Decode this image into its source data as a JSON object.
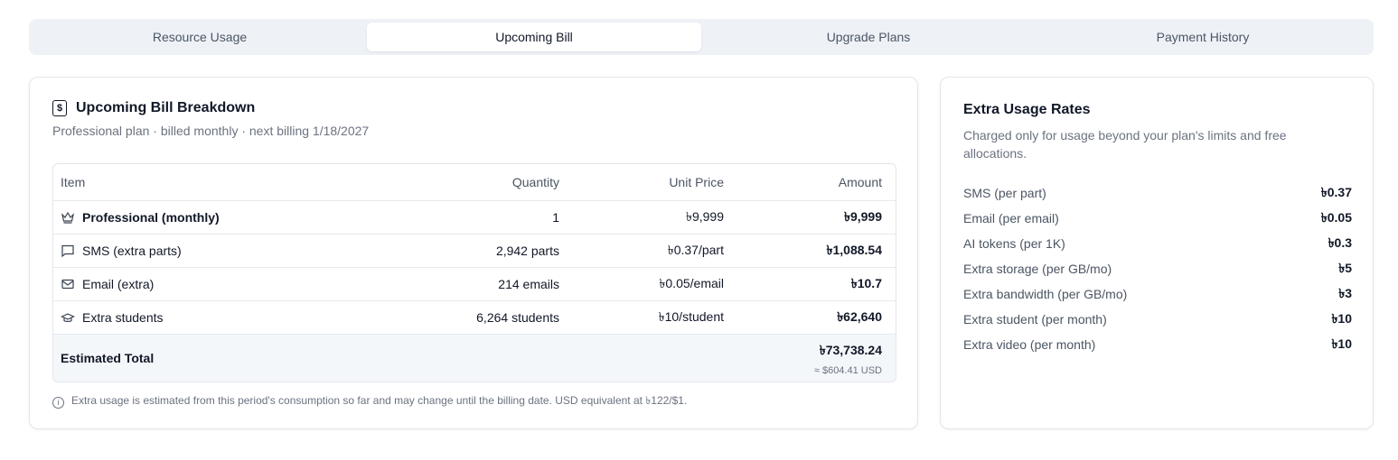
{
  "tabs": [
    {
      "label": "Resource Usage",
      "active": false
    },
    {
      "label": "Upcoming Bill",
      "active": true
    },
    {
      "label": "Upgrade Plans",
      "active": false
    },
    {
      "label": "Payment History",
      "active": false
    }
  ],
  "bill": {
    "icon": "bill-dollar-icon",
    "title": "Upcoming Bill Breakdown",
    "subtitle": "Professional plan · billed monthly · next billing 1/18/2027",
    "columns": {
      "item": "Item",
      "quantity": "Quantity",
      "unit_price": "Unit Price",
      "amount": "Amount"
    },
    "rows": [
      {
        "icon": "crown-icon",
        "item": "Professional (monthly)",
        "quantity": "1",
        "unit_price": "৳9,999",
        "amount": "৳9,999",
        "bold": true
      },
      {
        "icon": "message-icon",
        "item": "SMS (extra parts)",
        "quantity": "2,942 parts",
        "unit_price": "৳0.37/part",
        "amount": "৳1,088.54",
        "bold": false
      },
      {
        "icon": "mail-icon",
        "item": "Email (extra)",
        "quantity": "214 emails",
        "unit_price": "৳0.05/email",
        "amount": "৳10.7",
        "bold": false
      },
      {
        "icon": "graduation-cap-icon",
        "item": "Extra students",
        "quantity": "6,264 students",
        "unit_price": "৳10/student",
        "amount": "৳62,640",
        "bold": false
      }
    ],
    "total": {
      "label": "Estimated Total",
      "amount": "৳73,738.24",
      "usd": "≈ $604.41 USD"
    },
    "note": "Extra usage is estimated from this period's consumption so far and may change until the billing date. USD equivalent at ৳122/$1."
  },
  "rates": {
    "title": "Extra Usage Rates",
    "description": "Charged only for usage beyond your plan's limits and free allocations.",
    "items": [
      {
        "label": "SMS (per part)",
        "value": "৳0.37"
      },
      {
        "label": "Email (per email)",
        "value": "৳0.05"
      },
      {
        "label": "AI tokens (per 1K)",
        "value": "৳0.3"
      },
      {
        "label": "Extra storage (per GB/mo)",
        "value": "৳5"
      },
      {
        "label": "Extra bandwidth (per GB/mo)",
        "value": "৳3"
      },
      {
        "label": "Extra student (per month)",
        "value": "৳10"
      },
      {
        "label": "Extra video (per month)",
        "value": "৳10"
      }
    ]
  }
}
